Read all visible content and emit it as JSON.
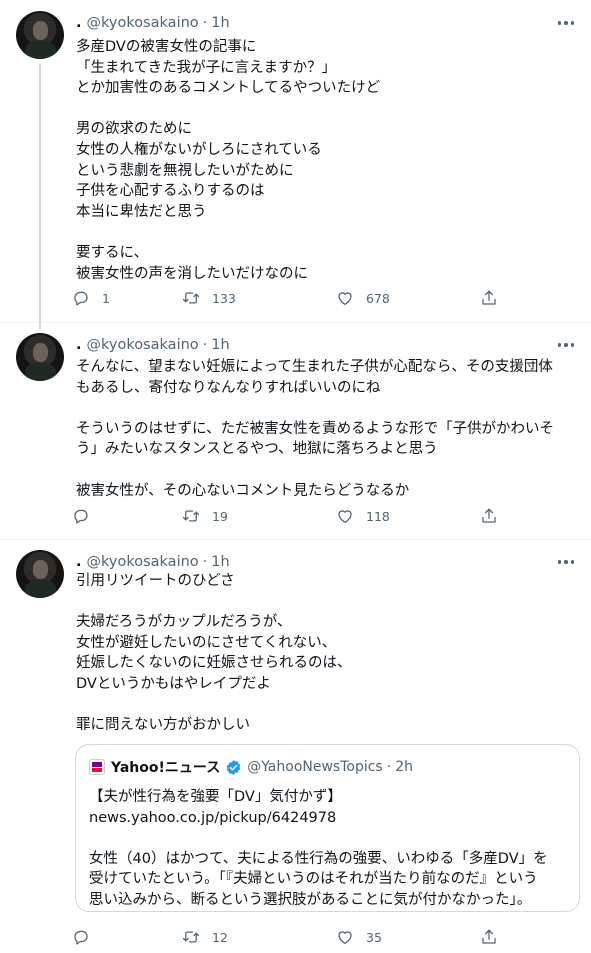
{
  "author": {
    "display_name": ".",
    "handle": "@kyokosakaino"
  },
  "tweets": [
    {
      "time": "1h",
      "lines": [
        "多産DVの被害女性の記事に",
        "「生まれてきた我が子に言えますか？」",
        "とか加害性のあるコメントしてるやついたけど",
        "",
        "男の欲求のために",
        "女性の人権がないがしろにされている",
        "という悲劇を無視したいがために",
        "子供を心配するふりするのは",
        "本当に卑怯だと思う",
        "",
        "要するに、",
        "被害女性の声を消したいだけなのに"
      ],
      "replies": "1",
      "retweets": "133",
      "likes": "678"
    },
    {
      "time": "1h",
      "lines": [
        "そんなに、望まない妊娠によって生まれた子供が心配なら、その支援団体",
        "もあるし、寄付なりなんなりすればいいのにね",
        "",
        "そういうのはせずに、ただ被害女性を責めるような形で「子供がかわいそ",
        "う」みたいなスタンスとるやつ、地獄に落ちろよと思う",
        "",
        "被害女性が、その心ないコメント見たらどうなるか"
      ],
      "replies": "",
      "retweets": "19",
      "likes": "118"
    },
    {
      "time": "1h",
      "lines": [
        "引用リツイートのひどさ",
        "",
        "夫婦だろうがカップルだろうが、",
        "女性が避妊したいのにさせてくれない、",
        "妊娠したくないのに妊娠させられるのは、",
        "DVというかもはやレイプだよ",
        "",
        "罪に問えない方がおかしい"
      ],
      "replies": "",
      "retweets": "12",
      "likes": "35"
    }
  ],
  "quote": {
    "name": "Yahoo!ニュース",
    "handle": "@YahooNewsTopics",
    "time": "2h",
    "headline": "【夫が性行為を強要「DV」気付かず】",
    "link": "news.yahoo.co.jp/pickup/6424978",
    "lines": [
      "女性（40）はかつて、夫による性行為の強要、いわゆる「多産DV」を",
      "受けていたという。「『夫婦というのはそれが当たり前なのだ』という",
      "思い込みから、断るという選択肢があることに気が付かなかった」。"
    ]
  },
  "icons": {
    "reply": "reply-icon",
    "retweet": "retweet-icon",
    "like": "heart-icon",
    "share": "share-icon",
    "more": "more-icon",
    "verified": "verified-badge-icon"
  },
  "colors": {
    "text": "#0f1419",
    "secondary": "#536471",
    "border": "#cfd9de",
    "separator": "#eff3f4",
    "verified": "#1d9bf0"
  }
}
